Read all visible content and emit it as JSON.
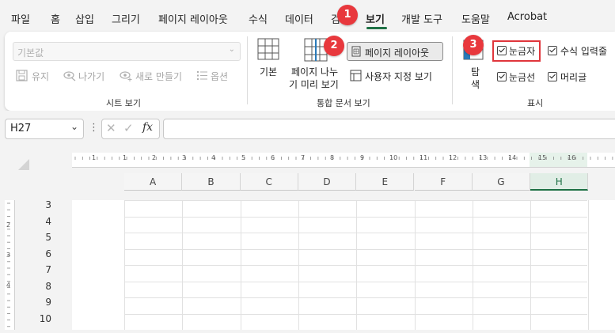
{
  "menu": {
    "items": [
      "파일",
      "홈",
      "삽입",
      "그리기",
      "페이지 레이아웃",
      "수식",
      "데이터",
      "검",
      "보기",
      "개발 도구",
      "도움말",
      "Acrobat"
    ],
    "active": "보기"
  },
  "badges": {
    "one": "1",
    "two": "2",
    "three": "3"
  },
  "sheet_view": {
    "dropdown_value": "기본값",
    "keep": "유지",
    "exit": "나가기",
    "new": "새로 만들기",
    "options": "옵션",
    "group_label": "시트 보기"
  },
  "workbook_view": {
    "normal": "기본",
    "page_break_1": "페이지 나누",
    "page_break_2": "기 미리 보기",
    "page_layout": "페이지 레이아웃",
    "custom_views": "사용자 지정 보기",
    "group_label": "통합 문서 보기"
  },
  "show": {
    "navigation_1": "탐",
    "navigation_2": "색",
    "gridlines": "눈금자",
    "formula_bar": "수식 입력줄",
    "gridlines2": "눈금선",
    "headings": "머리글",
    "group_label": "표시"
  },
  "formula_bar": {
    "name_box": "H27",
    "fx": "fx",
    "value": ""
  },
  "ruler_labels": [
    "1",
    "1",
    "2",
    "3",
    "4",
    "5",
    "6",
    "7",
    "8",
    "9",
    "10",
    "11",
    "12",
    "13",
    "14",
    "15",
    "16"
  ],
  "columns": [
    "A",
    "B",
    "C",
    "D",
    "E",
    "F",
    "G",
    "H"
  ],
  "selected_column": "H",
  "rows": [
    "3",
    "4",
    "5",
    "6",
    "7",
    "8",
    "9",
    "10"
  ],
  "left_ruler_labels": [
    "2",
    "3",
    "4"
  ],
  "colors": {
    "accent": "#1e7145",
    "badge": "#e8383d",
    "highlight_box": "#e0363c"
  }
}
